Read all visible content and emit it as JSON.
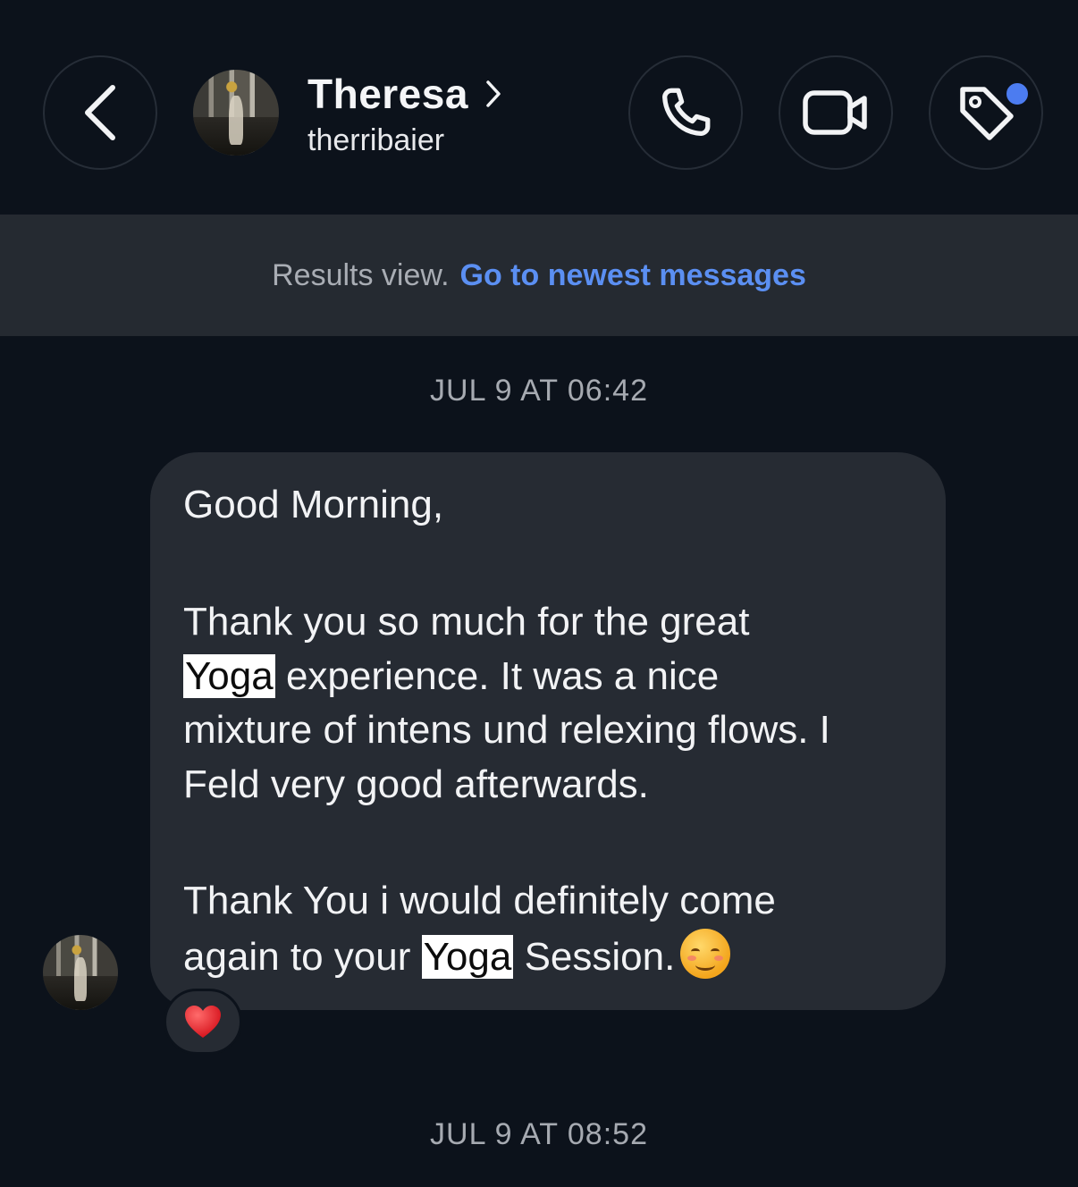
{
  "header": {
    "contact_name": "Theresa",
    "username": "therribaier",
    "has_notification_dot": true,
    "accent_color": "#4c7cf0"
  },
  "icons": {
    "back": "chevron-left-icon",
    "call": "phone-icon",
    "video": "video-camera-icon",
    "tag": "tag-icon"
  },
  "results_bar": {
    "text": "Results view.",
    "link": "Go to newest messages",
    "link_color": "#5b8ff2"
  },
  "messages": {
    "timestamp_1": "JUL 9 AT 06:42",
    "timestamp_2": "JUL 9 AT 08:52",
    "lines": {
      "l1": "Good Morning,",
      "l2": "Thank you so much for the great",
      "l3_hl": "Yoga",
      "l3_rest": " experience. It was a nice",
      "l4": "mixture of intens und relexing flows. I",
      "l5": "Feld very good afterwards.",
      "l6": "Thank You i would definitely come",
      "l7_pre": "again to your ",
      "l7_hl": "Yoga",
      "l7_post": " Session."
    },
    "reaction": "❤️"
  }
}
